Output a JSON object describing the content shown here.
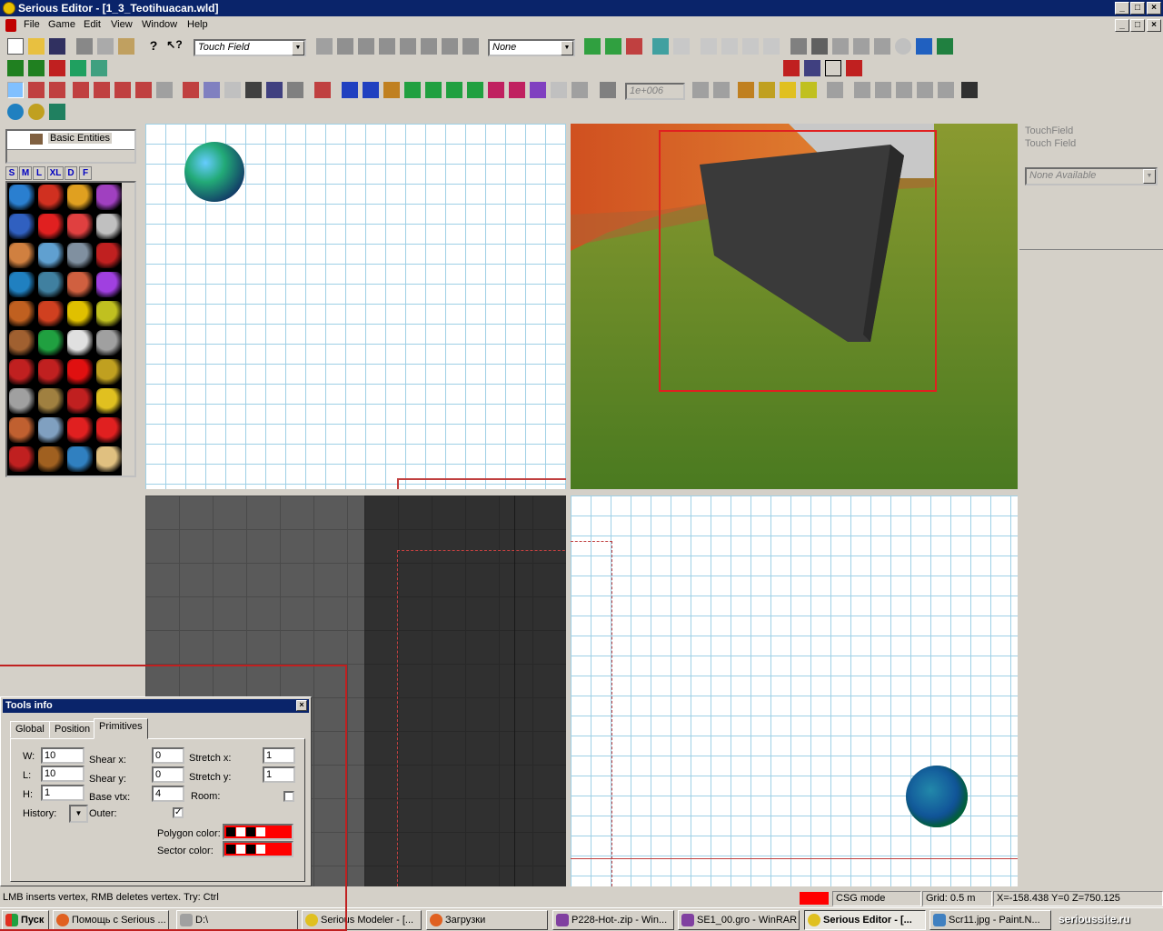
{
  "window": {
    "title": "Serious Editor - [1_3_Teotihuacan.wld]"
  },
  "menu": [
    "File",
    "Game",
    "Edit",
    "View",
    "Window",
    "Help"
  ],
  "toolbar": {
    "entity_combo": "Touch Field",
    "csg_combo": "None",
    "value_field": "1e+006"
  },
  "left_panel": {
    "tree_item": "Basic Entities",
    "size_tabs": [
      "S",
      "M",
      "L",
      "XL",
      "D",
      "F"
    ]
  },
  "right_panel": {
    "entity_name": "TouchField",
    "entity_class": "Touch Field",
    "property_combo": "None Available"
  },
  "tools_info": {
    "title": "Tools info",
    "tabs": [
      "Global",
      "Position",
      "Primitives"
    ],
    "active_tab": "Primitives",
    "labels": {
      "w": "W:",
      "l": "L:",
      "h": "H:",
      "history": "History:",
      "shear_x": "Shear x:",
      "shear_y": "Shear y:",
      "base_vtx": "Base vtx:",
      "outer": "Outer:",
      "stretch_x": "Stretch x:",
      "stretch_y": "Stretch y:",
      "room": "Room:",
      "polygon_color": "Polygon color:",
      "sector_color": "Sector color:"
    },
    "values": {
      "w": "10",
      "l": "10",
      "h": "1",
      "shear_x": "0",
      "shear_y": "0",
      "base_vtx": "4",
      "stretch_x": "1",
      "stretch_y": "1",
      "outer_checked": "✓"
    }
  },
  "status": {
    "hint": "LMB inserts vertex, RMB deletes vertex. Try: Ctrl",
    "mode": "CSG mode",
    "grid": "Grid: 0.5 m",
    "coords": "X=-158.438 Y=0 Z=750.125",
    "mode_color": "#ff0000"
  },
  "taskbar": {
    "start": "Пуск",
    "tasks": [
      "Помощь с Serious ...",
      "D:\\",
      "Serious Modeler - [...",
      "Загрузки",
      "P228-Hot-.zip - Win...",
      "SE1_00.gro - WinRAR",
      "Serious Editor - [...",
      "Scr11.jpg - Paint.N..."
    ],
    "active_index": 6,
    "watermark": "serioussite.ru"
  }
}
